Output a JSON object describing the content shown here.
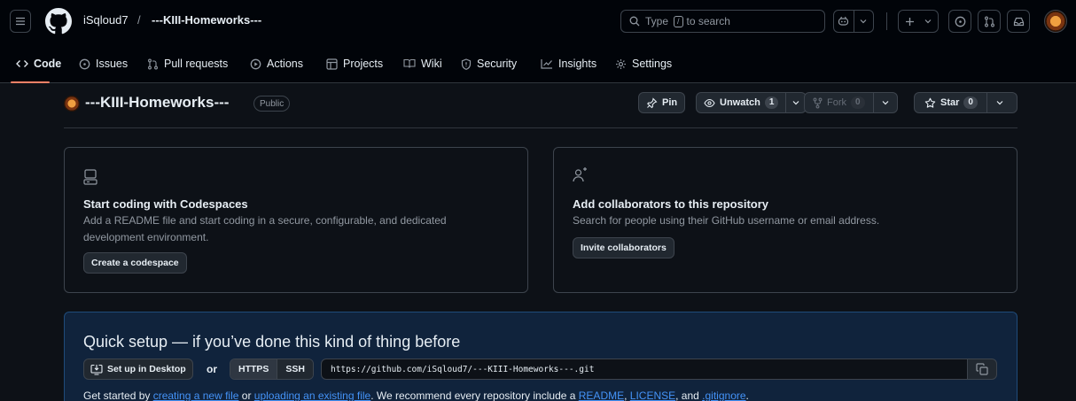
{
  "header": {
    "owner": "iSqloud7",
    "separator": "/",
    "repo": "---KIII-Homeworks---",
    "search": {
      "pre": "Type",
      "key": "/",
      "post": "to search"
    }
  },
  "tabs": [
    {
      "label": "Code",
      "icon": "code-icon"
    },
    {
      "label": "Issues",
      "icon": "issue-icon"
    },
    {
      "label": "Pull requests",
      "icon": "pull-request-icon"
    },
    {
      "label": "Actions",
      "icon": "play-icon"
    },
    {
      "label": "Projects",
      "icon": "table-icon"
    },
    {
      "label": "Wiki",
      "icon": "book-icon"
    },
    {
      "label": "Security",
      "icon": "shield-icon"
    },
    {
      "label": "Insights",
      "icon": "graph-icon"
    },
    {
      "label": "Settings",
      "icon": "gear-icon"
    }
  ],
  "repo": {
    "name": "---KIII-Homeworks---",
    "visibility": "Public",
    "pin_label": "Pin",
    "watch_label": "Unwatch",
    "watch_count": "1",
    "fork_label": "Fork",
    "fork_count": "0",
    "star_label": "Star",
    "star_count": "0"
  },
  "cards": {
    "codespaces": {
      "title": "Start coding with Codespaces",
      "desc_line1": "Add a README file and start coding in a secure, configurable, and dedicated",
      "desc_line2": "development environment.",
      "button": "Create a codespace"
    },
    "collaborators": {
      "title": "Add collaborators to this repository",
      "desc": "Search for people using their GitHub username or email address.",
      "button": "Invite collaborators"
    }
  },
  "quick_setup": {
    "title": "Quick setup — if you’ve done this kind of thing before",
    "desktop_button": "Set up in Desktop",
    "or": "or",
    "https": "HTTPS",
    "ssh": "SSH",
    "url": "https://github.com/iSqloud7/---KIII-Homeworks---.git",
    "desc": {
      "t1": "Get started by ",
      "l1": "creating a new file",
      "t2": " or ",
      "l2": "uploading an existing file",
      "t3": ". We recommend every repository include a ",
      "l3": "README",
      "t4": ", ",
      "l4": "LICENSE",
      "t5": ", and ",
      "l5": ".gitignore",
      "t6": "."
    }
  },
  "colors": {
    "background": "#0d1117",
    "header": "#010409",
    "accent_underline": "#f78166",
    "link": "#4493f8",
    "quick_setup_bg": "#10233c"
  }
}
